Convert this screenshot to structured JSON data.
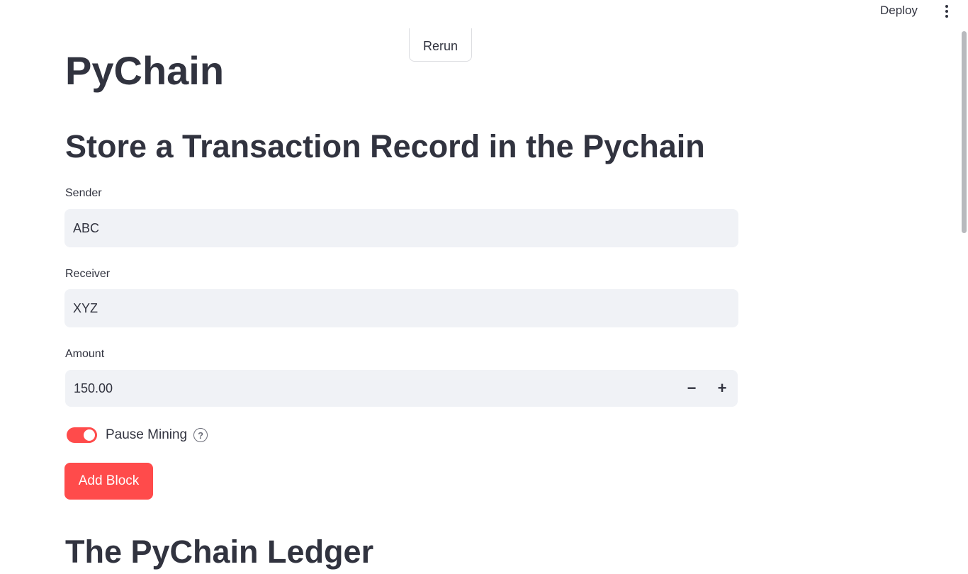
{
  "header": {
    "deploy_label": "Deploy",
    "menu_icon": "kebab-menu-icon"
  },
  "rerun_label": "Rerun",
  "page": {
    "title": "PyChain",
    "form_heading": "Store a Transaction Record in the Pychain",
    "ledger_heading": "The PyChain Ledger"
  },
  "form": {
    "sender": {
      "label": "Sender",
      "value": "ABC"
    },
    "receiver": {
      "label": "Receiver",
      "value": "XYZ"
    },
    "amount": {
      "label": "Amount",
      "value": "150.00",
      "minus": "−",
      "plus": "+"
    },
    "pause_mining": {
      "label": "Pause Mining",
      "checked": true,
      "help_icon": "question-circle-icon",
      "help_glyph": "?"
    },
    "add_block_label": "Add Block"
  },
  "colors": {
    "accent": "#ff4b4b",
    "input_bg": "#f0f2f6",
    "text": "#31333f"
  }
}
